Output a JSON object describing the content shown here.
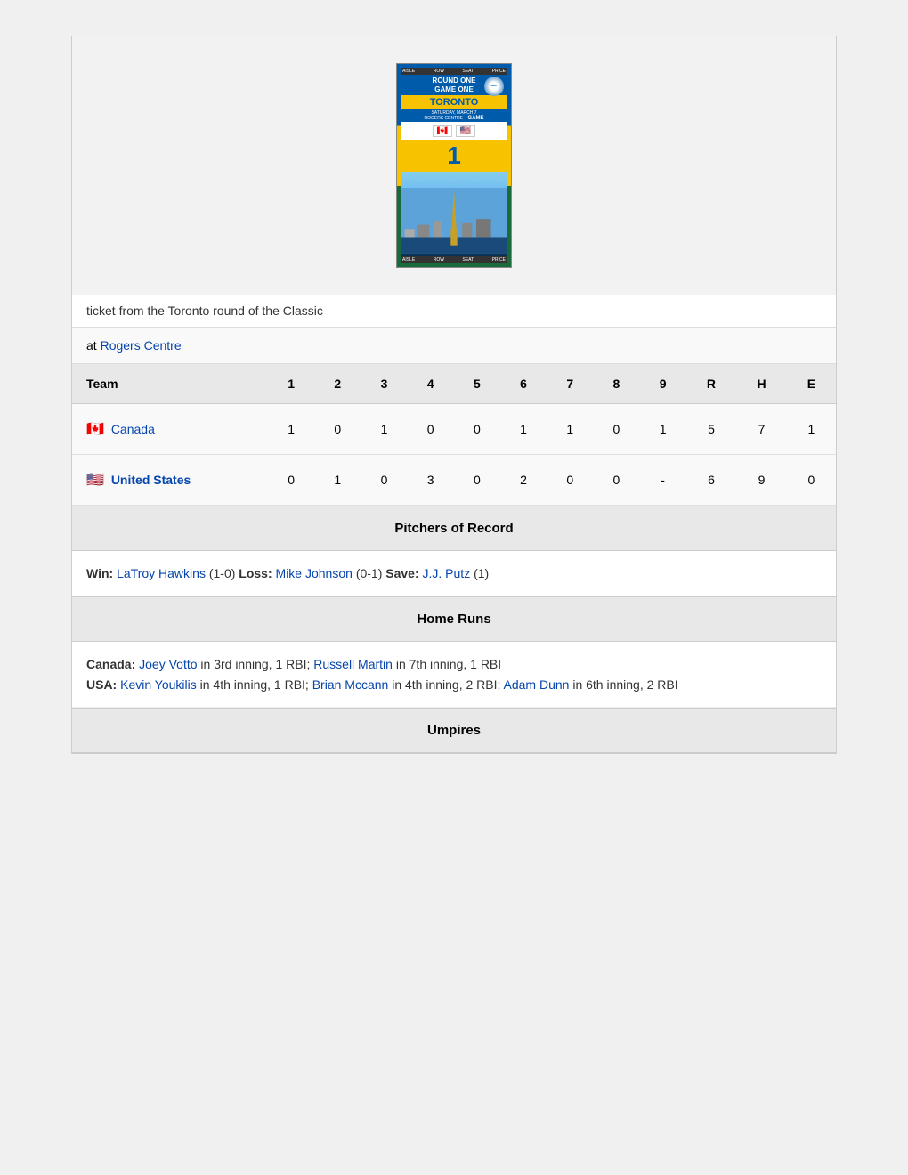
{
  "ticket": {
    "header_cols": [
      "AISLE",
      "ROW",
      "SEAT",
      "PRICE"
    ],
    "line1": "ROUND ONE",
    "line2": "GAME ONE",
    "city": "TORONTO",
    "date_text": "SATURDAY, MARCH 7",
    "venue_text": "ROGERS CENTRE",
    "game_number": "1",
    "footer_cols": [
      "AISLE",
      "ROW",
      "SEAT",
      "PRICE"
    ]
  },
  "caption": "ticket from the Toronto round of the Classic",
  "venue_prefix": "at",
  "venue_name": "Rogers Centre",
  "table": {
    "headers": [
      "Team",
      "1",
      "2",
      "3",
      "4",
      "5",
      "6",
      "7",
      "8",
      "9",
      "R",
      "H",
      "E"
    ],
    "rows": [
      {
        "flag": "🇨🇦",
        "team_name": "Canada",
        "innings": [
          "1",
          "0",
          "1",
          "0",
          "0",
          "1",
          "1",
          "0",
          "1"
        ],
        "r": "5",
        "h": "7",
        "e": "1"
      },
      {
        "flag": "🇺🇸",
        "team_name": "United States",
        "innings": [
          "0",
          "1",
          "0",
          "3",
          "0",
          "2",
          "0",
          "0",
          "-"
        ],
        "r": "6",
        "h": "9",
        "e": "0"
      }
    ]
  },
  "pitchers_header": "Pitchers of Record",
  "pitchers": {
    "win_label": "Win:",
    "win_player": "LaTroy Hawkins",
    "win_record": "(1-0)",
    "loss_label": "Loss:",
    "loss_player": "Mike Johnson",
    "loss_record": "(0-1)",
    "save_label": "Save:",
    "save_player": "J.J. Putz",
    "save_record": "(1)"
  },
  "home_runs_header": "Home Runs",
  "home_runs": {
    "canada_label": "Canada:",
    "canada_text": " in 3rd inning, 1 RBI; ",
    "canada_player1": "Joey Votto",
    "canada_player2": "Russell Martin",
    "canada_text2": " in 7th inning, 1 RBI",
    "usa_label": "USA:",
    "usa_player1": "Kevin Youkilis",
    "usa_text1": " in 4th inning, 1 RBI; ",
    "usa_player2": "Brian Mccann",
    "usa_text2": " in 4th inning, 2 RBI; ",
    "usa_player3": "Adam Dunn",
    "usa_text3": " in 6th inning, 2 RBI"
  },
  "umpires_header": "Umpires"
}
